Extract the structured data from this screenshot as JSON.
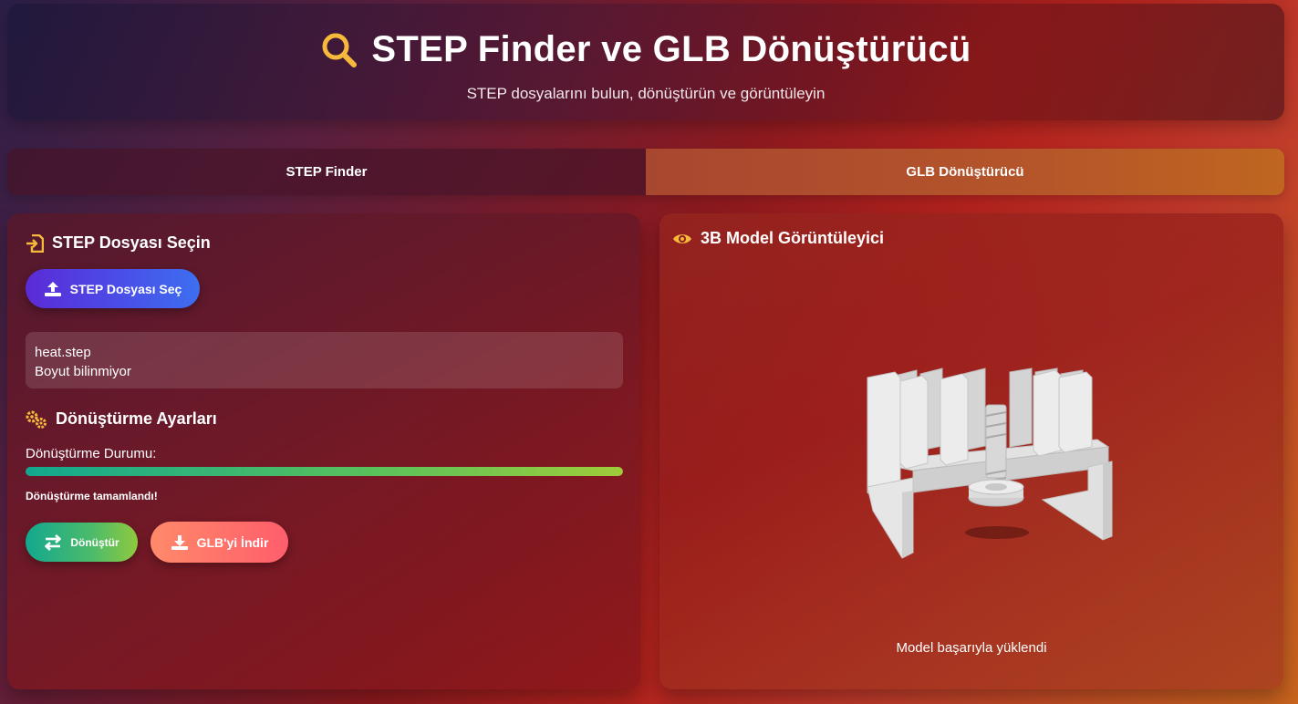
{
  "header": {
    "title": "STEP Finder ve GLB Dönüştürücü",
    "subtitle": "STEP dosyalarını bulun, dönüştürün ve görüntüleyin",
    "icon": "search-icon"
  },
  "tabs": [
    {
      "label": "STEP Finder",
      "active": false
    },
    {
      "label": "GLB Dönüştürücü",
      "active": true
    }
  ],
  "left_panel": {
    "file_section_title": "STEP Dosyası Seçin",
    "select_button_label": "STEP Dosyası Seç",
    "file": {
      "name": "heat.step",
      "size": "Boyut bilinmiyor"
    },
    "settings_title": "Dönüştürme Ayarları",
    "status_label": "Dönüştürme Durumu:",
    "progress_percent": 100,
    "status_message": "Dönüştürme tamamlandı!",
    "convert_button_label": "Dönüştür",
    "download_button_label": "GLB'yi İndir"
  },
  "right_panel": {
    "title": "3B Model Görüntüleyici",
    "model_status": "Model başarıyla yüklendi"
  },
  "colors": {
    "accent_yellow": "#f6b93b",
    "primary_button": "#4a4ee8",
    "convert_button": "#4dbb6a",
    "download_button": "#ff6f6a"
  }
}
